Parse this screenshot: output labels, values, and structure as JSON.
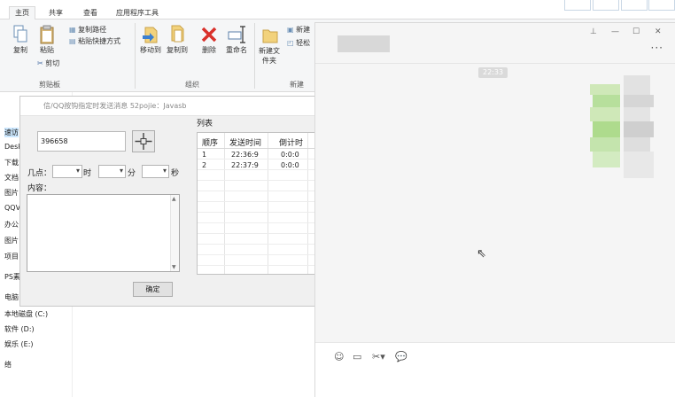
{
  "explorer": {
    "tabs": [
      "主页",
      "共享",
      "查看",
      "应用程序工具"
    ],
    "clipboard": {
      "copy": "复制",
      "paste": "粘贴",
      "copy_path": "复制路径",
      "paste_shortcut": "粘贴快捷方式",
      "cut": "剪切",
      "group": "剪贴板"
    },
    "organize": {
      "move_to": "移动到",
      "copy_to": "复制到",
      "delete": "删除",
      "rename": "重命名",
      "group": "组织"
    },
    "new_group": {
      "new_folder": "新建文件夹",
      "new_item": "新建",
      "easy_access": "轻松",
      "group": "新建"
    },
    "tree": [
      "速访",
      "Desk",
      "下载",
      "文档",
      "图片",
      "QQV",
      "办公",
      "图片",
      "项目",
      "PS素",
      "电脑",
      "本地磁盘 (C:)",
      "软件 (D:)",
      "娱乐 (E:)",
      "络"
    ]
  },
  "tool": {
    "title": "信/QQ按钩指定时发送消息 52pojie：Javasb",
    "qq_number": "396658",
    "time_labels": {
      "at": "几点：",
      "hour": "时",
      "minute": "分",
      "second": "秒"
    },
    "content_label": "内容：",
    "content_value": "",
    "confirm_label": "确定",
    "list": {
      "label": "列表",
      "columns": [
        "顺序",
        "发送时间",
        "倒计时"
      ],
      "rows": [
        {
          "order": "1",
          "time": "22:36:9",
          "countdown": "0:0:0"
        },
        {
          "order": "2",
          "time": "22:37:9",
          "countdown": "0:0:0"
        }
      ]
    }
  },
  "chat": {
    "time": "22:33",
    "controls": {
      "pin": "⊥",
      "minimize": "—",
      "maximize": "☐",
      "close": "✕"
    },
    "more": "···"
  }
}
